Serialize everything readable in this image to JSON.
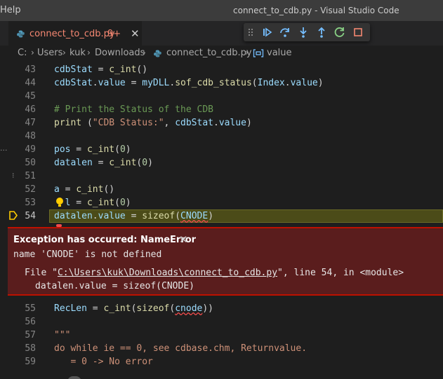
{
  "titlebar": {
    "menu_help": "Help",
    "window_title": "connect_to_cdb.py - Visual Studio Code"
  },
  "tab": {
    "label": "connect_to_cdb.py",
    "badge": "9+",
    "close": "✕"
  },
  "debug_toolbar": {
    "buttons": [
      "continue-icon",
      "step-over-icon",
      "step-into-icon",
      "step-out-icon",
      "restart-icon",
      "stop-icon"
    ],
    "colors": {
      "blue": "#75beff",
      "green": "#89d185",
      "red": "#f48771"
    }
  },
  "breadcrumb": {
    "items": [
      "C:",
      "Users",
      "kuk",
      "Downloads",
      "connect_to_cdb.py",
      "value"
    ],
    "sep": "›"
  },
  "editor": {
    "lines": [
      {
        "n": "43",
        "parts": [
          [
            "var",
            "cdbStat"
          ],
          [
            "",
            " = "
          ],
          [
            "fn",
            "c_int"
          ],
          [
            "",
            "()"
          ]
        ]
      },
      {
        "n": "44",
        "parts": [
          [
            "var",
            "cdbStat"
          ],
          [
            "",
            "."
          ],
          [
            "var",
            "value"
          ],
          [
            "",
            " = "
          ],
          [
            "var",
            "myDLL"
          ],
          [
            "",
            "."
          ],
          [
            "fn",
            "sof_cdb_status"
          ],
          [
            "",
            "("
          ],
          [
            "var",
            "Index"
          ],
          [
            "",
            "."
          ],
          [
            "var",
            "value"
          ],
          [
            "",
            ")"
          ]
        ]
      },
      {
        "n": "45",
        "parts": []
      },
      {
        "n": "46",
        "parts": [
          [
            "cmt",
            "# Print the Status of the CDB"
          ]
        ]
      },
      {
        "n": "47",
        "parts": [
          [
            "fn",
            "print"
          ],
          [
            "",
            " ("
          ],
          [
            "str",
            "\"CDB Status:\""
          ],
          [
            "",
            ", "
          ],
          [
            "var",
            "cdbStat"
          ],
          [
            "",
            "."
          ],
          [
            "var",
            "value"
          ],
          [
            "",
            ")"
          ]
        ]
      },
      {
        "n": "48",
        "parts": []
      },
      {
        "n": "49",
        "parts": [
          [
            "var",
            "pos"
          ],
          [
            "",
            " = "
          ],
          [
            "fn",
            "c_int"
          ],
          [
            "",
            "("
          ],
          [
            "num",
            "0"
          ],
          [
            "",
            ")"
          ]
        ]
      },
      {
        "n": "50",
        "parts": [
          [
            "var",
            "datalen"
          ],
          [
            "",
            " = "
          ],
          [
            "fn",
            "c_int"
          ],
          [
            "",
            "("
          ],
          [
            "num",
            "0"
          ],
          [
            "",
            ")"
          ]
        ]
      },
      {
        "n": "51",
        "parts": []
      },
      {
        "n": "52",
        "parts": [
          [
            "var",
            "a"
          ],
          [
            "",
            " = "
          ],
          [
            "fn",
            "c_int"
          ],
          [
            "",
            "()"
          ]
        ]
      },
      {
        "n": "53",
        "parts": [
          [
            "",
            "  "
          ],
          [
            "var",
            "l"
          ],
          [
            "",
            " = "
          ],
          [
            "fn",
            "c_int"
          ],
          [
            "",
            "("
          ],
          [
            "num",
            "0"
          ],
          [
            "",
            ")"
          ]
        ]
      },
      {
        "n": "54",
        "current": true,
        "parts": [
          [
            "var",
            "datalen"
          ],
          [
            "",
            "."
          ],
          [
            "var",
            "value"
          ],
          [
            "",
            " = "
          ],
          [
            "fn",
            "sizeof"
          ],
          [
            "",
            "("
          ],
          [
            "var squig",
            "CNODE"
          ],
          [
            "",
            ")"
          ]
        ]
      },
      {
        "n": "55",
        "parts": [
          [
            "var",
            "RecLen"
          ],
          [
            "",
            " = "
          ],
          [
            "fn",
            "c_int"
          ],
          [
            "",
            "("
          ],
          [
            "fn",
            "sizeof"
          ],
          [
            "",
            "("
          ],
          [
            "var squig",
            "cnode"
          ],
          [
            "",
            "))"
          ]
        ]
      },
      {
        "n": "56",
        "parts": []
      },
      {
        "n": "57",
        "parts": [
          [
            "str",
            "\"\"\""
          ]
        ]
      },
      {
        "n": "58",
        "parts": [
          [
            "str",
            "do while ie == 0, see cdbase.chm, Returnvalue."
          ]
        ]
      },
      {
        "n": "59",
        "parts": [
          [
            "str",
            "   = 0 -> No error"
          ]
        ]
      }
    ]
  },
  "exception": {
    "title": "Exception has occurred: NameError",
    "close": "✕",
    "message": "name 'CNODE' is not defined",
    "trace_prefix": "File \"",
    "trace_path": "C:\\Users\\kuk\\Downloads\\connect_to_cdb.py",
    "trace_suffix": "\", line 54, in <module>",
    "trace_code": "datalen.value = sizeof(CNODE)"
  }
}
